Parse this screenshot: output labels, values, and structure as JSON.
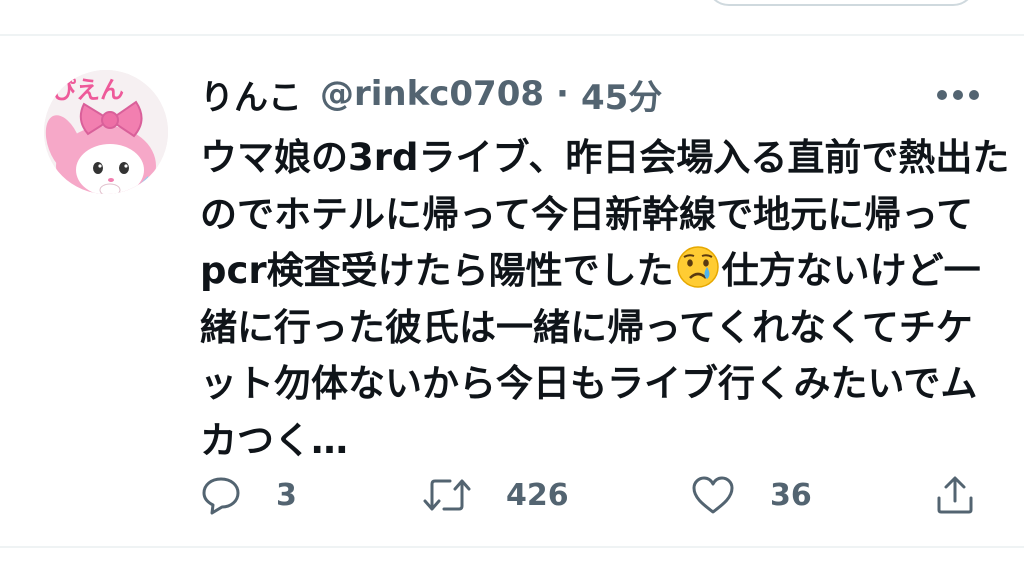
{
  "tweet": {
    "display_name": "りんこ",
    "handle": "@rinkc0708",
    "separator": "·",
    "time": "45分",
    "text_lines": [
      [
        "ウマ娘の3rdライブ、昨日会場入る直前で熱出た"
      ],
      [
        "のでホテルに帰って今日新幹線で地元に帰って"
      ],
      [
        "pcr検査受けたら陽性でした",
        "仕方ないけど一"
      ],
      [
        "緒に行った彼氏は一緒に帰ってくれなくてチケ"
      ],
      [
        "ット勿体ないから今日もライブ行くみたいでム"
      ],
      [
        "カつく…"
      ]
    ],
    "emoji": "crying-face",
    "avatar_text": "ぴえん"
  },
  "actions": {
    "reply_count": "3",
    "retweet_count": "426",
    "like_count": "36"
  },
  "colors": {
    "text": "#0f1419",
    "secondary": "#536471",
    "divider": "#eff3f4",
    "avatar_pink": "#f27fb0"
  }
}
